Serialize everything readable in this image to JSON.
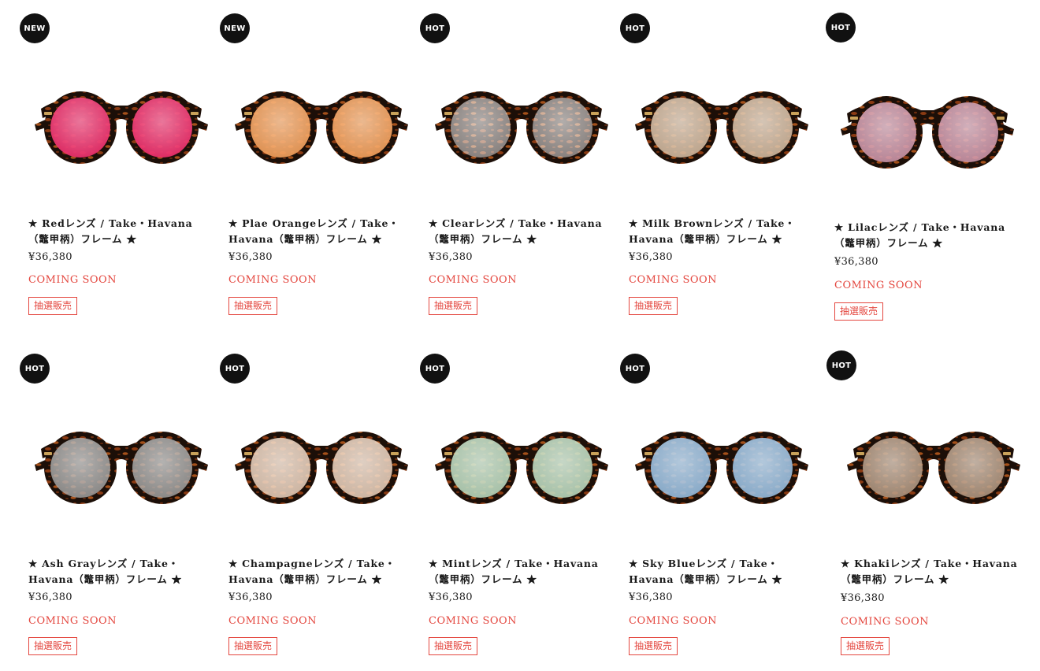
{
  "products": [
    {
      "badge": "NEW",
      "title": "★ Redレンズ / Take・Havana（鼈甲柄）フレーム ★",
      "price": "¥36,380",
      "status": "COMING SOON",
      "tag": "抽選販売",
      "lens_color": "#ee2f6c",
      "tint_opacity": 0.92
    },
    {
      "badge": "NEW",
      "title": "★ Plae Orangeレンズ / Take・Havana（鼈甲柄）フレーム ★",
      "price": "¥36,380",
      "status": "COMING SOON",
      "tag": "抽選販売",
      "lens_color": "#f5a15c",
      "tint_opacity": 0.9
    },
    {
      "badge": "HOT",
      "title": "★ Clearレンズ / Take・Havana（鼈甲柄）フレーム ★",
      "price": "¥36,380",
      "status": "COMING SOON",
      "tag": "抽選販売",
      "lens_color": "#f3f3f3",
      "tint_opacity": 0.5
    },
    {
      "badge": "HOT",
      "title": "★ Milk Brownレンズ / Take・Havana（鼈甲柄）フレーム ★",
      "price": "¥36,380",
      "status": "COMING SOON",
      "tag": "抽選販売",
      "lens_color": "#d9c0a4",
      "tint_opacity": 0.85
    },
    {
      "badge": "HOT",
      "title": "★ Lilacレンズ / Take・Havana（鼈甲柄）フレーム ★",
      "price": "¥36,380",
      "status": "COMING SOON",
      "tag": "抽選販売",
      "lens_color": "#d39aaf",
      "tint_opacity": 0.85
    },
    {
      "badge": "HOT",
      "title": "★ Ash Grayレンズ / Take・Havana（鼈甲柄）フレーム ★",
      "price": "¥36,380",
      "status": "COMING SOON",
      "tag": "抽選販売",
      "lens_color": "#a8a8a8",
      "tint_opacity": 0.8
    },
    {
      "badge": "HOT",
      "title": "★ Champagneレンズ / Take・Havana（鼈甲柄）フレーム ★",
      "price": "¥36,380",
      "status": "COMING SOON",
      "tag": "抽選販売",
      "lens_color": "#ecd2bd",
      "tint_opacity": 0.85
    },
    {
      "badge": "HOT",
      "title": "★ Mintレンズ / Take・Havana（鼈甲柄）フレーム ★",
      "price": "¥36,380",
      "status": "COMING SOON",
      "tag": "抽選販売",
      "lens_color": "#bfe0c4",
      "tint_opacity": 0.85
    },
    {
      "badge": "HOT",
      "title": "★ Sky Blueレンズ / Take・Havana（鼈甲柄）フレーム ★",
      "price": "¥36,380",
      "status": "COMING SOON",
      "tag": "抽選販売",
      "lens_color": "#9cc6ea",
      "tint_opacity": 0.85
    },
    {
      "badge": "HOT",
      "title": "★ Khakiレンズ / Take・Havana（鼈甲柄）フレーム ★",
      "price": "¥36,380",
      "status": "COMING SOON",
      "tag": "抽選販売",
      "lens_color": "#b59a82",
      "tint_opacity": 0.85
    }
  ],
  "colors": {
    "accent_red": "#e4473f",
    "badge_bg": "#111111",
    "frame_dark": "#1c0f08",
    "frame_tortoise": "#8a3a12"
  }
}
